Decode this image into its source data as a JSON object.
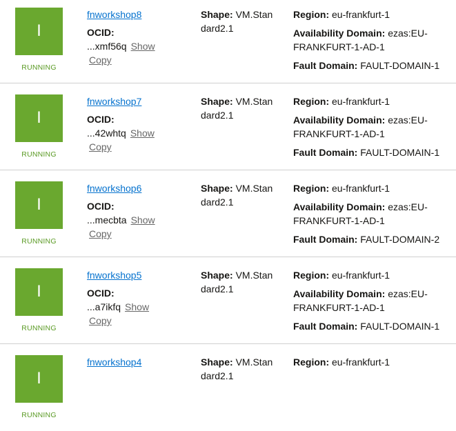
{
  "labels": {
    "ocid": "OCID:",
    "shape": "Shape:",
    "region": "Region:",
    "availability_domain": "Availability Domain:",
    "fault_domain": "Fault Domain:",
    "show": "Show",
    "copy": "Copy"
  },
  "colors": {
    "status_running": "#6aa82f",
    "link": "#0572ce"
  },
  "instances": [
    {
      "name": "fnworkshop8",
      "status": "RUNNING",
      "status_glyph": "I",
      "ocid_short": "...xmf56q",
      "shape": "VM.Standard2.1",
      "region": "eu-frankfurt-1",
      "availability_domain": "ezas:EU-FRANKFURT-1-AD-1",
      "fault_domain": "FAULT-DOMAIN-1"
    },
    {
      "name": "fnworkshop7",
      "status": "RUNNING",
      "status_glyph": "I",
      "ocid_short": "...42whtq",
      "shape": "VM.Standard2.1",
      "region": "eu-frankfurt-1",
      "availability_domain": "ezas:EU-FRANKFURT-1-AD-1",
      "fault_domain": "FAULT-DOMAIN-1"
    },
    {
      "name": "fnworkshop6",
      "status": "RUNNING",
      "status_glyph": "I",
      "ocid_short": "...mecbta",
      "shape": "VM.Standard2.1",
      "region": "eu-frankfurt-1",
      "availability_domain": "ezas:EU-FRANKFURT-1-AD-1",
      "fault_domain": "FAULT-DOMAIN-2"
    },
    {
      "name": "fnworkshop5",
      "status": "RUNNING",
      "status_glyph": "I",
      "ocid_short": "...a7ikfq",
      "shape": "VM.Standard2.1",
      "region": "eu-frankfurt-1",
      "availability_domain": "ezas:EU-FRANKFURT-1-AD-1",
      "fault_domain": "FAULT-DOMAIN-1"
    },
    {
      "name": "fnworkshop4",
      "status": "RUNNING",
      "status_glyph": "I",
      "ocid_short": "",
      "shape": "VM.Standard2.1",
      "region": "eu-frankfurt-1",
      "availability_domain": "",
      "fault_domain": ""
    }
  ]
}
